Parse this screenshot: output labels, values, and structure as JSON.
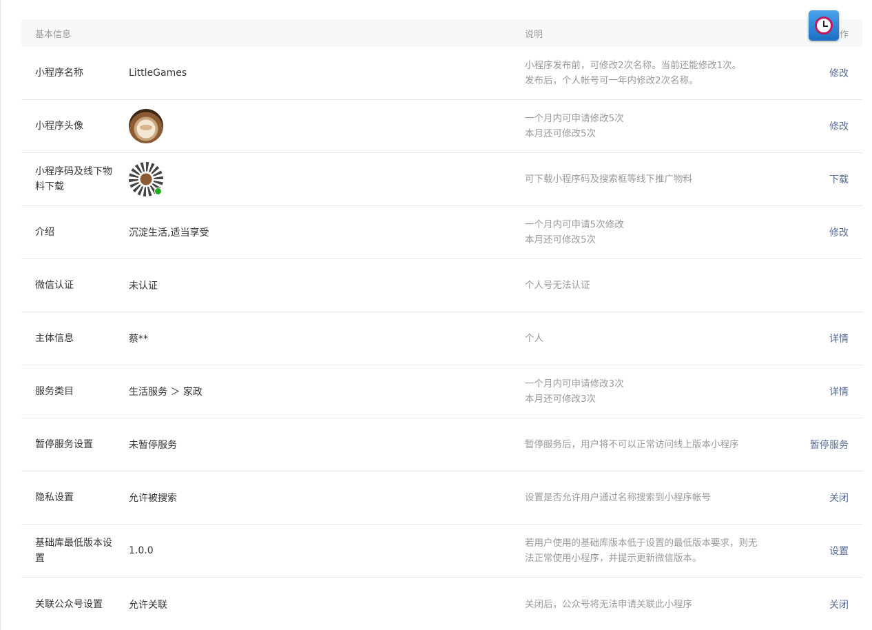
{
  "header": {
    "col_basic": "基本信息",
    "col_desc": "说明",
    "col_action": "操作"
  },
  "rows": [
    {
      "label": "小程序名称",
      "value": "LittleGames",
      "desc": [
        "小程序发布前，可修改2次名称。当前还能修改1次。",
        "发布后，个人帐号可一年内修改2次名称。"
      ],
      "action": "修改"
    },
    {
      "label": "小程序头像",
      "value": "",
      "desc": [
        "一个月内可申请修改5次",
        "本月还可修改5次"
      ],
      "action": "修改"
    },
    {
      "label": "小程序码及线下物料下载",
      "value": "",
      "desc": [
        "可下载小程序码及搜索框等线下推广物料"
      ],
      "action": "下载"
    },
    {
      "label": "介绍",
      "value": "沉淀生活,适当享受",
      "desc": [
        "一个月内可申请5次修改",
        "本月还可修改5次"
      ],
      "action": "修改"
    },
    {
      "label": "微信认证",
      "value": "未认证",
      "desc": [
        "个人号无法认证"
      ],
      "action": ""
    },
    {
      "label": "主体信息",
      "value": "蔡**",
      "desc": [
        "个人"
      ],
      "action": "详情"
    },
    {
      "label": "服务类目",
      "value": "生活服务 ＞ 家政",
      "desc": [
        "一个月内可申请修改3次",
        "本月还可修改3次"
      ],
      "action": "详情"
    },
    {
      "label": "暂停服务设置",
      "value": "未暂停服务",
      "desc": [
        "暂停服务后，用户将不可以正常访问线上版本小程序"
      ],
      "action": "暂停服务"
    },
    {
      "label": "隐私设置",
      "value": "允许被搜索",
      "desc": [
        "设置是否允许用户通过名称搜索到小程序帐号"
      ],
      "action": "关闭"
    },
    {
      "label": "基础库最低版本设置",
      "value": "1.0.0",
      "desc": [
        "若用户使用的基础库版本低于设置的最低版本要求，则无",
        "法正常使用小程序，并提示更新微信版本。"
      ],
      "action": "设置"
    },
    {
      "label": "关联公众号设置",
      "value": "允许关联",
      "desc": [
        "关闭后，公众号将无法申请关联此小程序"
      ],
      "action": "关闭"
    }
  ],
  "colors": {
    "link": "#576b95",
    "muted": "#9a9a9a",
    "text": "#353535"
  }
}
